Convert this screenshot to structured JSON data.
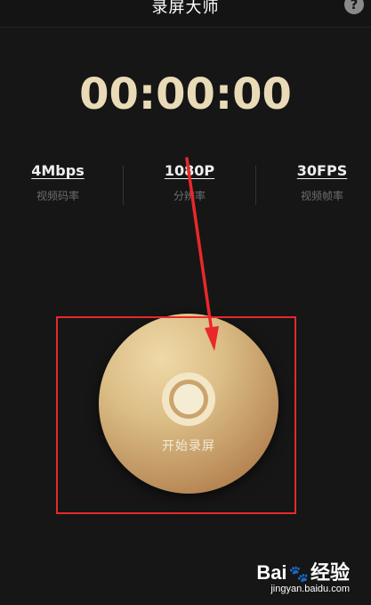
{
  "header": {
    "title": "录屏大师",
    "help_label": "?"
  },
  "timer": "00:00:00",
  "stats": [
    {
      "value": "4Mbps",
      "label": "视频码率"
    },
    {
      "value": "1080P",
      "label": "分辨率"
    },
    {
      "value": "30FPS",
      "label": "视频帧率"
    }
  ],
  "record": {
    "label": "开始录屏"
  },
  "watermark": {
    "logo_left": "Bai",
    "logo_right": "经验",
    "sub": "jingyan.baidu.com"
  },
  "colors": {
    "background": "#161616",
    "timer": "#eadbb8",
    "annotation": "#e8282a",
    "button_gold": "#d9b97f"
  },
  "icons": {
    "help": "question-mark-icon",
    "record": "record-circle-icon",
    "paw": "paw-icon"
  }
}
